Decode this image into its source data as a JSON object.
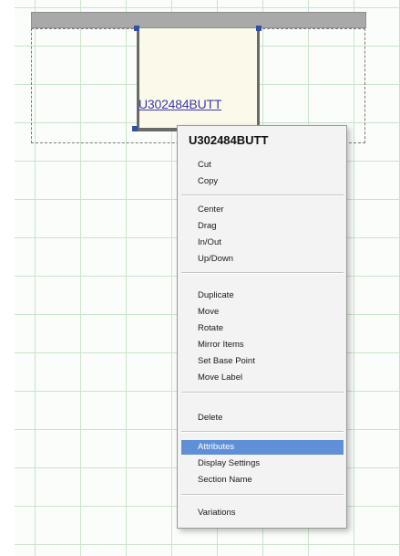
{
  "canvas": {
    "component_label": "U302484BUTT"
  },
  "context_menu": {
    "title": "U302484BUTT",
    "groups": [
      [
        "Cut",
        "Copy"
      ],
      [
        "Center",
        "Drag",
        "In/Out",
        "Up/Down"
      ],
      [
        "Duplicate",
        "Move",
        "Rotate",
        "Mirror Items",
        "Set Base Point",
        "Move Label"
      ],
      [
        "Delete"
      ],
      [
        "Attributes",
        "Display Settings",
        "Section Name"
      ],
      [
        "Variations"
      ]
    ],
    "selected_item": "Attributes",
    "selected_color": "#5f8fd6"
  }
}
